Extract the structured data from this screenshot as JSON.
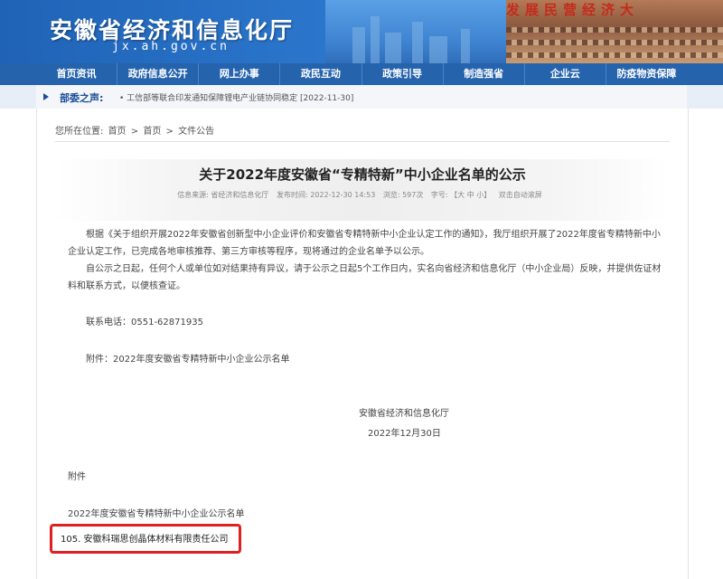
{
  "header": {
    "title": "安徽省经济和信息化厅",
    "domain": "jx.ah.gov.cn",
    "slogan": "发展民营经济大"
  },
  "nav": {
    "items": [
      "首页资讯",
      "政府信息公开",
      "网上办事",
      "政民互动",
      "政策引导",
      "制造强省",
      "企业云",
      "防疫物资保障"
    ]
  },
  "news": {
    "label": "部委之声:",
    "text": "• 工信部等联合印发通知保障锂电产业链协同稳定 [2022-11-30]"
  },
  "breadcrumb": {
    "prefix": "您所在位置:",
    "items": [
      "首页",
      "首页",
      "文件公告"
    ]
  },
  "article": {
    "title": "关于2022年度安徽省“专精特新”中小企业名单的公示",
    "meta": {
      "source": "信息来源: 省经济和信息化厅",
      "time": "发布时间: 2022-12-30 14:53",
      "views": "浏览: 597次",
      "size": "字号: 【大 中 小】",
      "scroll": "双击自动滚屏"
    },
    "paragraphs": [
      "根据《关于组织开展2022年安徽省创新型中小企业评价和安徽省专精特新中小企业认定工作的通知》，我厅组织开展了2022年度省专精特新中小企业认定工作，已完成各地审核推荐、第三方审核等程序，现将通过的企业名单予以公示。",
      "自公示之日起，任何个人或单位如对结果持有异议，请于公示之日起5个工作日内，实名向省经济和信息化厅（中小企业局）反映，并提供佐证材料和联系方式，以便核查证。"
    ],
    "phone": "联系电话：0551-62871935",
    "attachment_line": "附件：2022年度安徽省专精特新中小企业公示名单",
    "signature_org": "安徽省经济和信息化厅",
    "signature_date": "2022年12月30日",
    "appendix_label": "附件",
    "appendix_title": "2022年度安徽省专精特新中小企业公示名单",
    "highlighted_entry": "105. 安徽科瑞思创晶体材料有限责任公司"
  }
}
